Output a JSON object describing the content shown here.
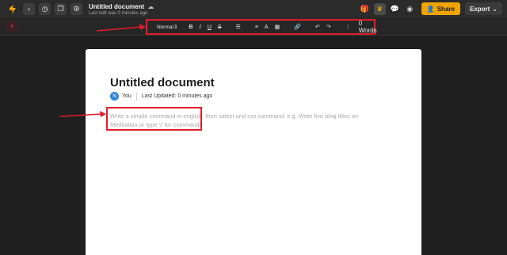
{
  "topbar": {
    "doc_title": "Untitled document",
    "last_edit": "Last edit was 0 minutes ago",
    "share_label": "Share",
    "export_label": "Export"
  },
  "toolbar": {
    "style_value": "Normal",
    "word_count": "0 Words"
  },
  "document": {
    "heading": "Untitled document",
    "avatar_initial": "N",
    "author": "You",
    "last_updated": "Last Updated: 0 minutes ago",
    "placeholder": "Write a simple command in english, then select and run command. e.g. Write five blog titles on Meditation or type '/' for commands"
  },
  "colors": {
    "accent": "#f0a400",
    "annotation": "#e11d2a",
    "background": "#1f1f1f",
    "avatar": "#2f86e0"
  },
  "icons": {
    "top_left": [
      "app-logo-icon",
      "back-icon",
      "history-icon",
      "copy-icon",
      "settings-icon"
    ],
    "top_right": [
      "gift-icon",
      "crown-icon",
      "comment-icon",
      "eye-icon",
      "share-person-icon",
      "chevron-down-icon"
    ],
    "format": [
      "bold-icon",
      "italic-icon",
      "underline-icon",
      "strikethrough-icon",
      "bullet-list-icon",
      "align-icon",
      "text-color-icon",
      "highlight-icon",
      "link-icon",
      "undo-icon",
      "redo-icon",
      "more-icon"
    ]
  }
}
